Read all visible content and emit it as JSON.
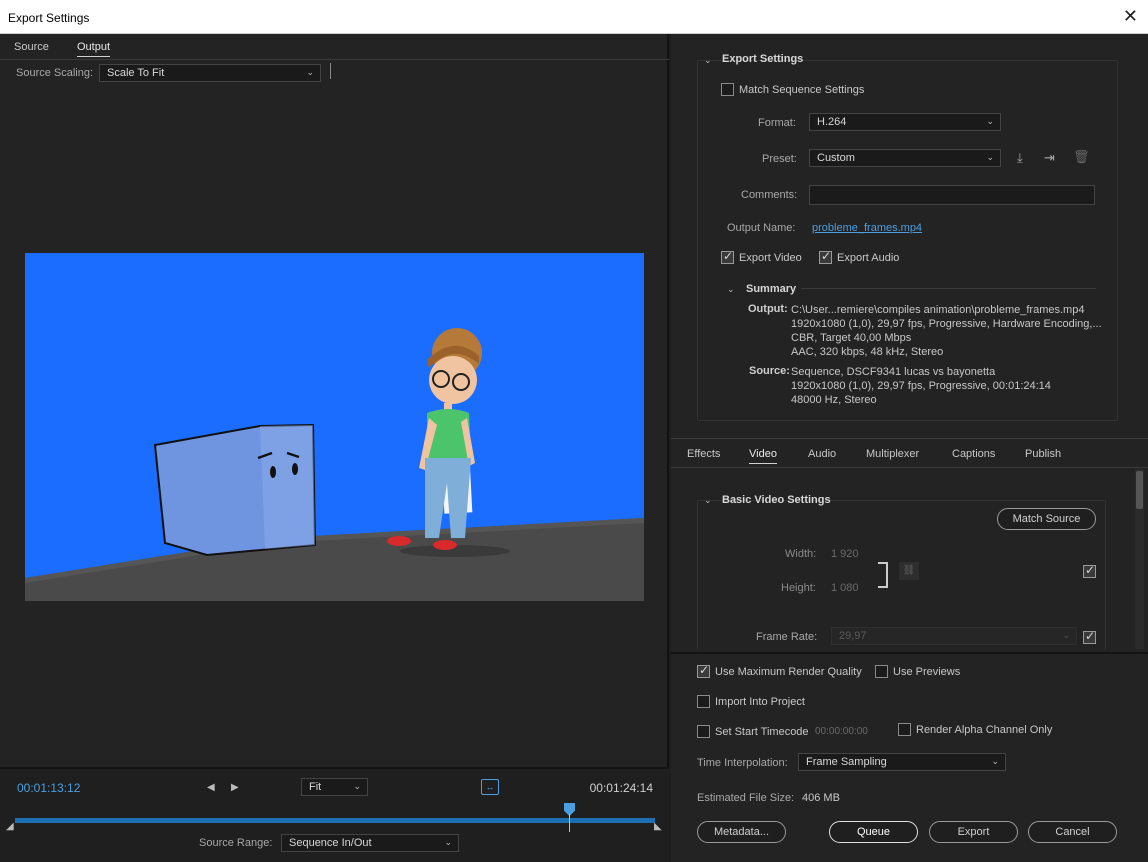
{
  "window": {
    "title": "Export Settings",
    "close_glyph": "✕"
  },
  "left": {
    "tabs": [
      "Source",
      "Output"
    ],
    "source_scaling_label": "Source Scaling:",
    "source_scaling_value": "Scale To Fit",
    "timeline": {
      "current_tc": "00:01:13:12",
      "end_tc": "00:01:24:14",
      "zoom_value": "Fit",
      "source_range_label": "Source Range:",
      "source_range_value": "Sequence In/Out",
      "playhead_progress": 0.866
    }
  },
  "right": {
    "export_settings": {
      "heading": "Export Settings",
      "match_sequence_label": "Match Sequence Settings",
      "format_label": "Format:",
      "format_value": "H.264",
      "preset_label": "Preset:",
      "preset_value": "Custom",
      "comments_label": "Comments:",
      "output_name_label": "Output Name:",
      "output_name_value": "probleme_frames.mp4",
      "export_video_label": "Export Video",
      "export_audio_label": "Export Audio"
    },
    "summary": {
      "heading": "Summary",
      "output_label": "Output:",
      "output_lines": [
        "C:\\User...remiere\\compiles animation\\probleme_frames.mp4",
        "1920x1080 (1,0), 29,97 fps, Progressive, Hardware Encoding,...",
        "CBR, Target 40,00 Mbps",
        "AAC, 320 kbps, 48 kHz, Stereo"
      ],
      "source_label": "Source:",
      "source_lines": [
        "Sequence, DSCF9341 lucas vs bayonetta",
        "1920x1080 (1,0), 29,97 fps, Progressive, 00:01:24:14",
        "48000 Hz, Stereo"
      ]
    },
    "tabs": [
      "Effects",
      "Video",
      "Audio",
      "Multiplexer",
      "Captions",
      "Publish"
    ],
    "basic_video": {
      "heading": "Basic Video Settings",
      "match_source_label": "Match Source",
      "width_label": "Width:",
      "width_value": "1 920",
      "height_label": "Height:",
      "height_value": "1 080",
      "frame_rate_label": "Frame Rate:",
      "frame_rate_value": "29,97"
    },
    "options": {
      "max_render_label": "Use Maximum Render Quality",
      "use_previews_label": "Use Previews",
      "import_project_label": "Import Into Project",
      "start_tc_label": "Set Start Timecode",
      "start_tc_value": "00:00:00:00",
      "render_alpha_label": "Render Alpha Channel Only",
      "time_interp_label": "Time Interpolation:",
      "time_interp_value": "Frame Sampling",
      "file_size_label": "Estimated File Size:",
      "file_size_value": "406 MB"
    },
    "buttons": {
      "metadata": "Metadata...",
      "queue": "Queue",
      "export": "Export",
      "cancel": "Cancel"
    }
  },
  "colors": {
    "accent": "#4b9fe0",
    "preview_bg": "#1a6dff",
    "panel": "#232323"
  }
}
